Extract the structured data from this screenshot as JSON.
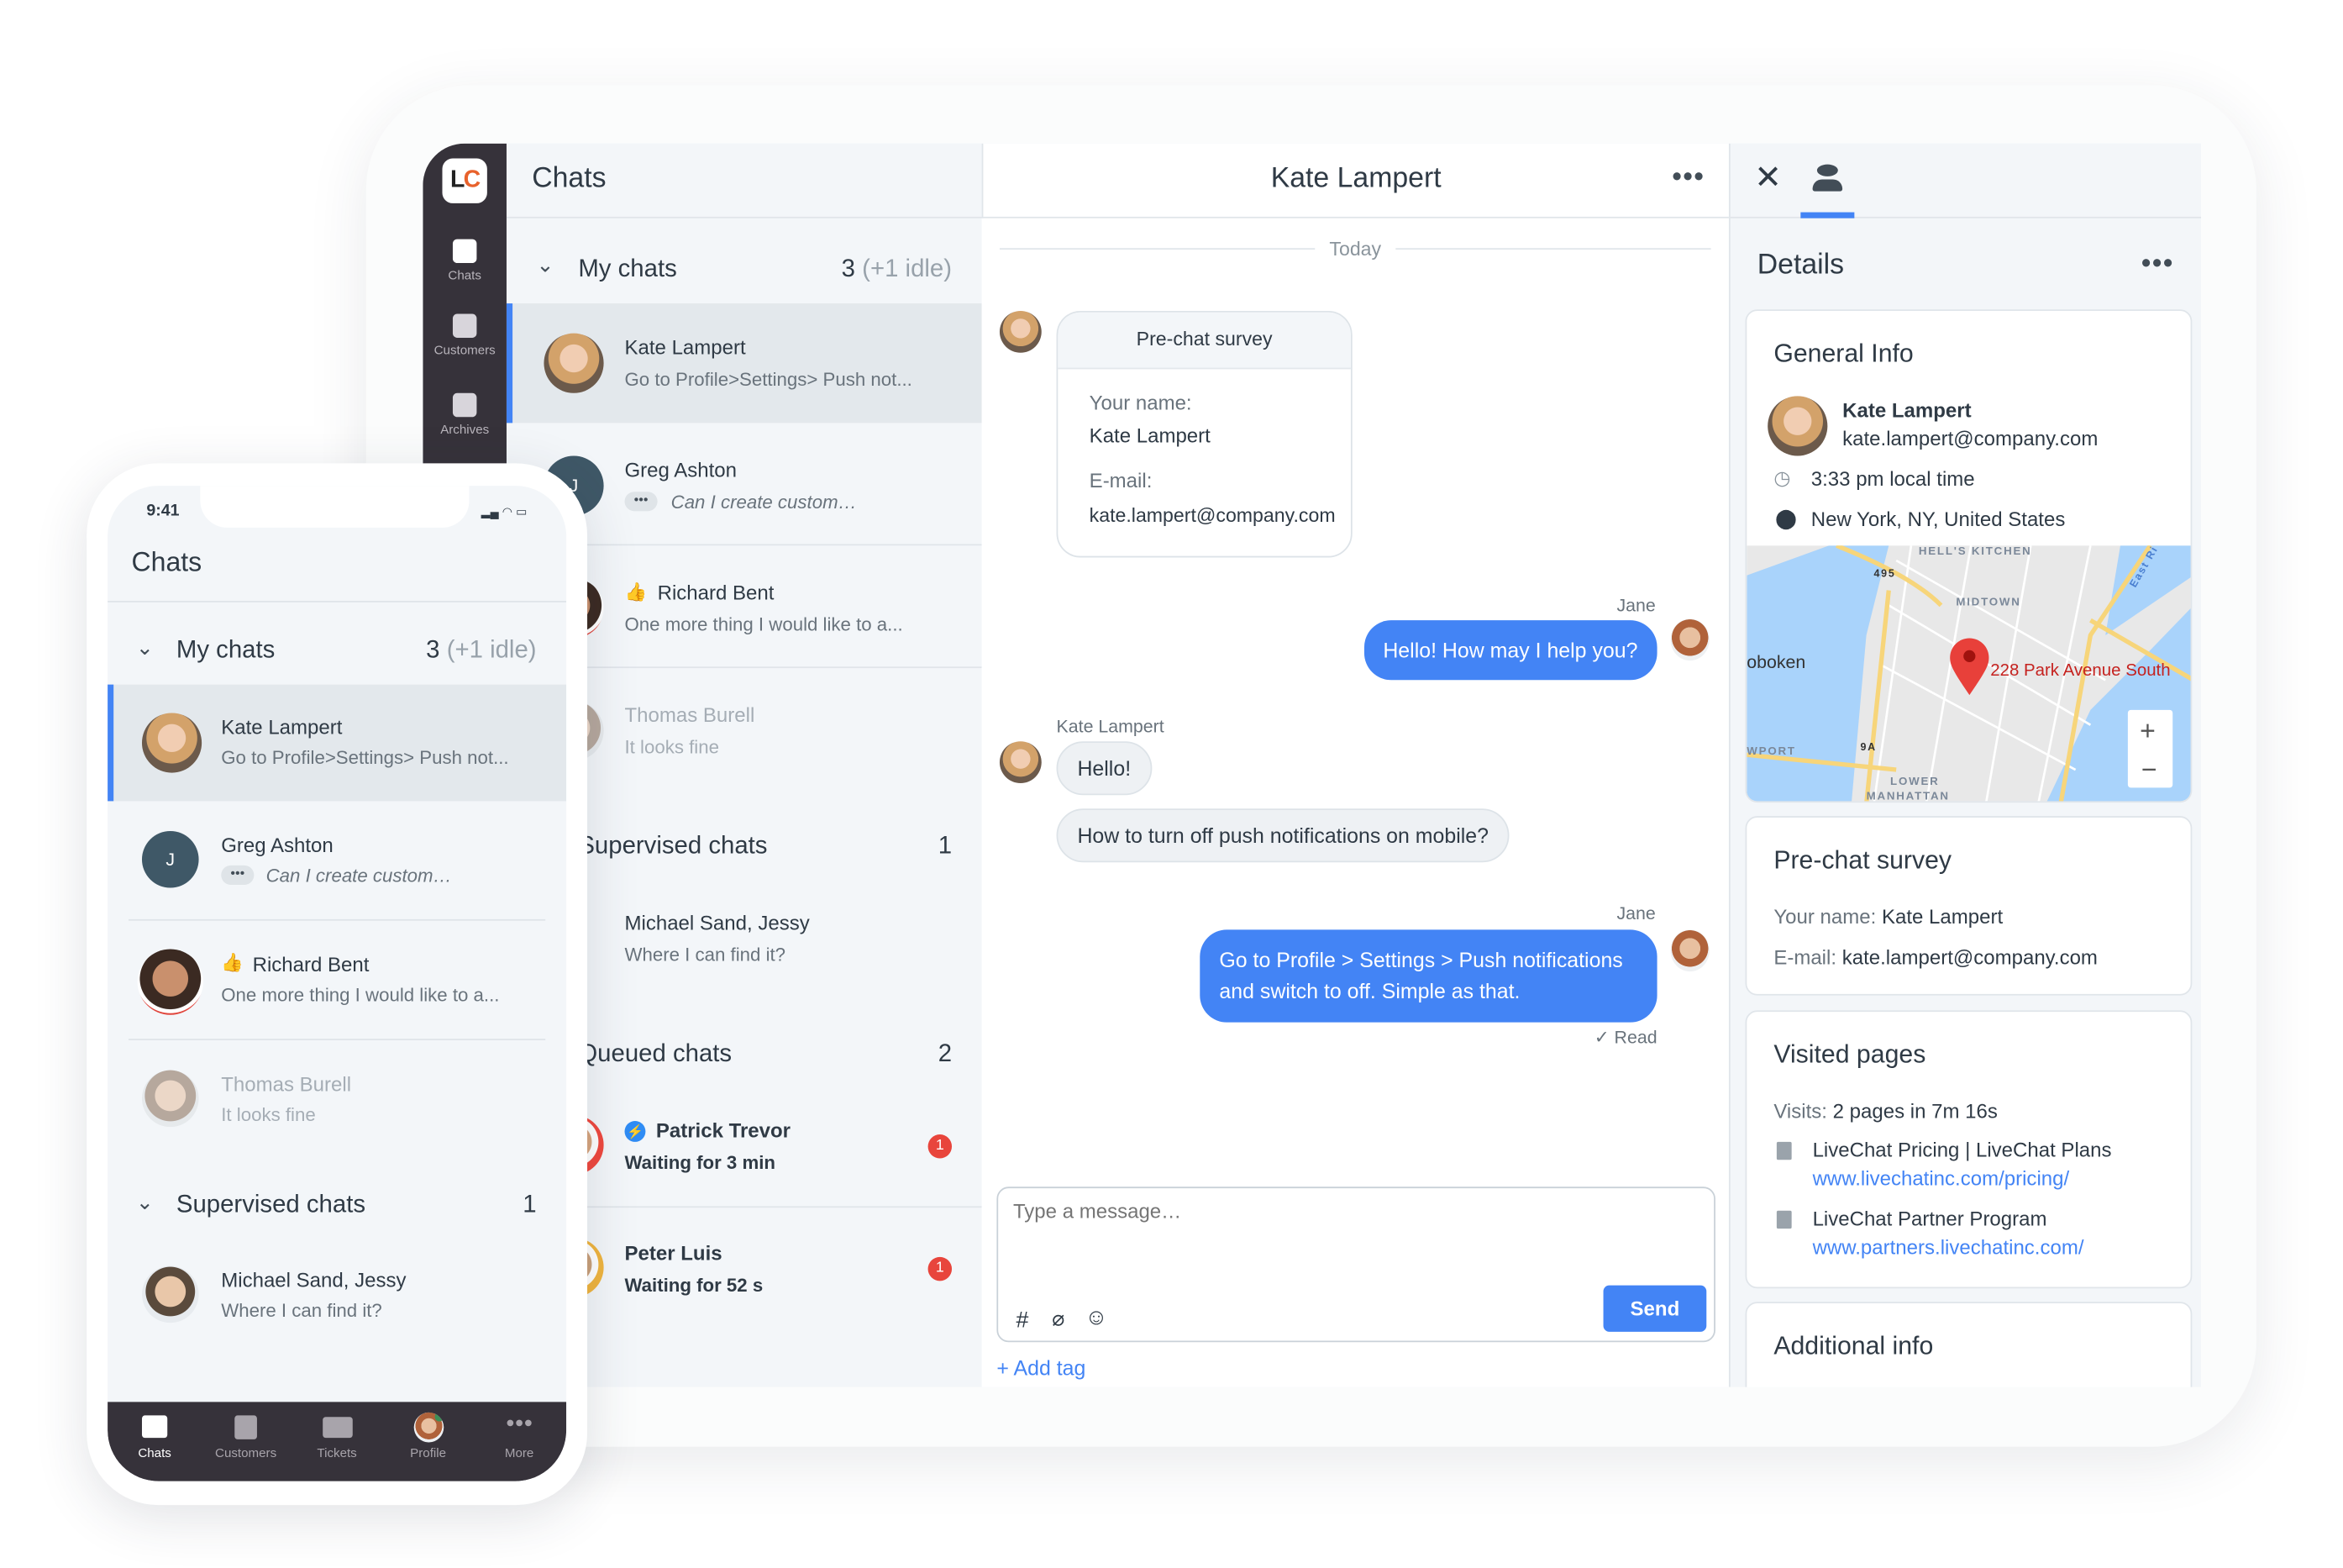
{
  "rail": {
    "logo": "LC",
    "items": [
      {
        "label": "Chats",
        "icon": "chat-bubbles-icon"
      },
      {
        "label": "Customers",
        "icon": "customer-card-icon"
      },
      {
        "label": "Archives",
        "icon": "inbox-icon"
      }
    ]
  },
  "list": {
    "title": "Chats",
    "my_chats": {
      "label": "My chats",
      "count": "3",
      "idle": "(+1 idle)"
    },
    "chats": [
      {
        "name": "Kate Lampert",
        "preview": "Go to Profile>Settings> Push not..."
      },
      {
        "name": "Greg Ashton",
        "preview": "Can I create custom…",
        "initial": "J"
      },
      {
        "name": "Richard Bent",
        "preview": "One more thing I would like to a..."
      },
      {
        "name": "Thomas Burell",
        "preview": "It looks fine"
      }
    ],
    "supervised": {
      "label": "Supervised chats",
      "count": "1",
      "items": [
        {
          "name": "Michael Sand, Jessy",
          "preview": "Where I can find it?"
        }
      ]
    },
    "queued": {
      "label": "Queued chats",
      "count": "2",
      "items": [
        {
          "name": "Patrick Trevor",
          "preview": "Waiting for 3 min",
          "badge": "1"
        },
        {
          "name": "Peter Luis",
          "preview": "Waiting for 52 s",
          "badge": "1"
        }
      ]
    }
  },
  "chat": {
    "title": "Kate Lampert",
    "date": "Today",
    "survey": {
      "title": "Pre-chat survey",
      "name_label": "Your name:",
      "name": "Kate Lampert",
      "email_label": "E-mail:",
      "email": "kate.lampert@company.com"
    },
    "messages": [
      {
        "author": "Jane",
        "text": "Hello! How may I help you?"
      },
      {
        "author": "Kate Lampert",
        "text": "Hello!"
      },
      {
        "author": "",
        "text": "How to turn off push notifications on mobile?"
      },
      {
        "author": "Jane",
        "text": "Go to Profile > Settings > Push notifications and switch to off. Simple as that.",
        "status": "✓ Read"
      }
    ],
    "composer": {
      "placeholder": "Type a message…",
      "send": "Send",
      "add_tag": "+ Add tag"
    }
  },
  "details": {
    "title": "Details",
    "general": {
      "title": "General Info",
      "name": "Kate Lampert",
      "email": "kate.lampert@company.com",
      "time": "3:33 pm local time",
      "location": "New York, NY, United States",
      "map": {
        "pin_label": "228 Park Avenue South",
        "labels": [
          "HELL'S KITCHEN",
          "MIDTOWN",
          "oboken",
          "WPORT",
          "LOWER",
          "MANHATTAN",
          "495",
          "9A",
          "East Ri"
        ]
      }
    },
    "survey": {
      "title": "Pre-chat survey",
      "name_label": "Your name:",
      "name": "Kate Lampert",
      "email_label": "E-mail:",
      "email": "kate.lampert@company.com"
    },
    "visited": {
      "title": "Visited pages",
      "visits_label": "Visits:",
      "visits": "2 pages in 7m 16s",
      "pages": [
        {
          "title": "LiveChat Pricing | LiveChat Plans",
          "url": "www.livechatinc.com/pricing/"
        },
        {
          "title": "LiveChat Partner Program",
          "url": "www.partners.livechatinc.com/"
        }
      ]
    },
    "additional": {
      "title": "Additional info"
    }
  },
  "phone": {
    "time": "9:41",
    "title": "Chats",
    "my_chats": {
      "label": "My chats",
      "count": "3",
      "idle": "(+1 idle)"
    },
    "supervised": {
      "label": "Supervised chats",
      "count": "1"
    },
    "nav": [
      {
        "label": "Chats"
      },
      {
        "label": "Customers"
      },
      {
        "label": "Tickets"
      },
      {
        "label": "Profile"
      },
      {
        "label": "More"
      }
    ]
  },
  "colors": {
    "accent": "#4384f5",
    "rail": "#36323a",
    "badge": "#e8453c",
    "panel": "#f3f6f9"
  }
}
